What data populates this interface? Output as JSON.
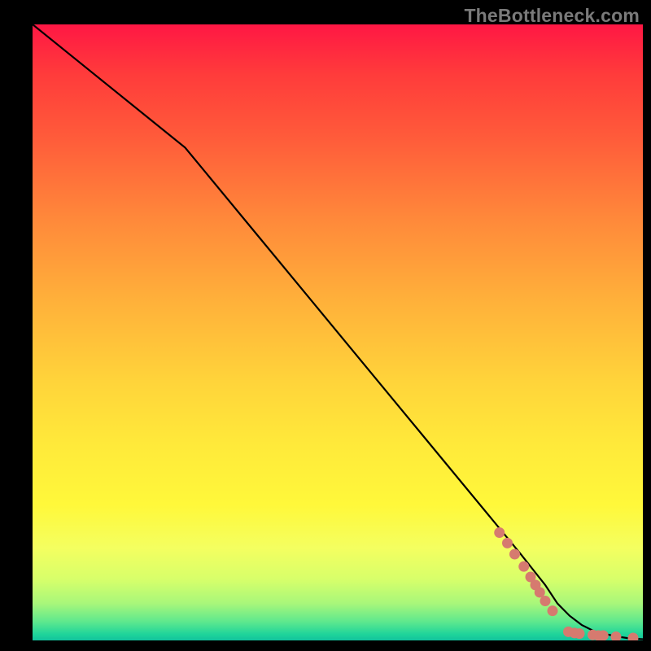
{
  "attribution": "TheBottleneck.com",
  "colors": {
    "marker": "#d67a6f",
    "curve": "#000000",
    "background_top": "#ff1744",
    "background_bottom": "#12c29c",
    "frame": "#000000"
  },
  "chart_data": {
    "type": "line",
    "title": "",
    "xlabel": "",
    "ylabel": "",
    "xlim": [
      0,
      100
    ],
    "ylim": [
      0,
      100
    ],
    "grid": false,
    "legend": false,
    "series": [
      {
        "name": "curve",
        "x": [
          0,
          10,
          20,
          25,
          35,
          45,
          55,
          65,
          75,
          80,
          84,
          86,
          88,
          90,
          92,
          94,
          96,
          98,
          100
        ],
        "y": [
          100,
          92,
          84,
          80,
          68,
          56,
          44,
          32,
          20,
          14,
          9,
          6,
          4,
          2.5,
          1.5,
          1,
          0.6,
          0.3,
          0.2
        ]
      }
    ],
    "markers": [
      {
        "x": 76.5,
        "y": 17.5
      },
      {
        "x": 77.8,
        "y": 15.8
      },
      {
        "x": 79.0,
        "y": 14.0
      },
      {
        "x": 80.5,
        "y": 12.0
      },
      {
        "x": 81.6,
        "y": 10.3
      },
      {
        "x": 82.4,
        "y": 9.0
      },
      {
        "x": 83.1,
        "y": 7.8
      },
      {
        "x": 84.0,
        "y": 6.4
      },
      {
        "x": 85.2,
        "y": 4.8
      },
      {
        "x": 87.8,
        "y": 1.4
      },
      {
        "x": 88.8,
        "y": 1.2
      },
      {
        "x": 89.6,
        "y": 1.1
      },
      {
        "x": 91.8,
        "y": 0.9
      },
      {
        "x": 92.7,
        "y": 0.8
      },
      {
        "x": 93.5,
        "y": 0.8
      },
      {
        "x": 95.6,
        "y": 0.6
      },
      {
        "x": 98.4,
        "y": 0.4
      }
    ],
    "marker_radius_px": 6.5
  }
}
